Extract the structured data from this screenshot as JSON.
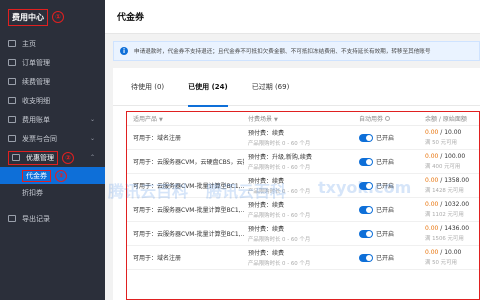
{
  "sidebar": {
    "title": "费用中心",
    "title_marker": "①",
    "items": [
      {
        "label": "主页"
      },
      {
        "label": "订单管理"
      },
      {
        "label": "续费管理"
      },
      {
        "label": "收支明细"
      },
      {
        "label": "费用账单",
        "chev": "⌄"
      },
      {
        "label": "发票与合同",
        "chev": "⌄"
      }
    ],
    "active_parent": {
      "label": "优惠管理",
      "marker": "②",
      "chev": "⌃"
    },
    "sub_items": [
      {
        "label": "代金券",
        "marker": "③"
      },
      {
        "label": "折扣券"
      }
    ],
    "export": {
      "label": "导出记录"
    }
  },
  "header": {
    "title": "代金券"
  },
  "notice": {
    "icon": "i",
    "text": "申请退款时，代金券不支持退还；且代金券不可抵扣欠费金额、不可抵扣冻结费用、不支持延长有效期，转移至其他账号"
  },
  "tabs": [
    {
      "label": "待使用 (0)"
    },
    {
      "label": "已使用 (24)"
    },
    {
      "label": "已过期 (69)"
    }
  ],
  "table": {
    "headers": {
      "product": "适用产品",
      "scene": "付费场景",
      "auto": "自动用券",
      "balance": "余额 / 原始面额"
    },
    "filter_icon": "▼",
    "rows": [
      {
        "usable_prefix": "可用于：",
        "usable": "域名注册",
        "scene": "预付费：续费",
        "scene_sub": "产品限购时长 0 - 60 个月",
        "auto": "已开启",
        "bal": "0.00",
        "total": " / 10.00",
        "bal_sub": "满 50 元可用"
      },
      {
        "usable_prefix": "可用于：",
        "usable": "云服务器CVM，云硬盘CBS，云数...",
        "scene": "预付费：升级,新购,续费",
        "scene_sub": "产品限购时长 0 - 60 个月",
        "auto": "已开启",
        "bal": "0.00",
        "total": " / 100.00",
        "bal_sub": "满 400 元可用"
      },
      {
        "usable_prefix": "可用于：",
        "usable": "云服务器CVM-批量计算型BC1,...",
        "scene": "预付费：续费",
        "scene_sub": "产品限购时长 0 - 60 个月",
        "auto": "已开启",
        "bal": "0.00",
        "total": " / 1358.00",
        "bal_sub": "满 1428 元可用"
      },
      {
        "usable_prefix": "可用于：",
        "usable": "云服务器CVM-批量计算型BC1,...",
        "scene": "预付费：续费",
        "scene_sub": "产品限购时长 0 - 60 个月",
        "auto": "已开启",
        "bal": "0.00",
        "total": " / 1032.00",
        "bal_sub": "满 1102 元可用"
      },
      {
        "usable_prefix": "可用于：",
        "usable": "云服务器CVM-批量计算型BC1,...",
        "scene": "预付费：续费",
        "scene_sub": "产品限购时长 0 - 60 个月",
        "auto": "已开启",
        "bal": "0.00",
        "total": " / 1436.00",
        "bal_sub": "满 1506 元可用"
      },
      {
        "usable_prefix": "可用于：",
        "usable": "域名注册",
        "scene": "预付费：续费",
        "scene_sub": "产品限购时长 0 - 60 个月",
        "auto": "已开启",
        "bal": "0.00",
        "total": " / 10.00",
        "bal_sub": "满 50 元可用"
      }
    ]
  },
  "watermark": {
    "text1": "腾讯云百科",
    "text2": "txyok.com"
  },
  "colors": {
    "accent": "#0e6fd8",
    "marker_red": "#e02020",
    "balance_orange": "#e8730a",
    "sidebar_bg": "#2b2f3a"
  }
}
